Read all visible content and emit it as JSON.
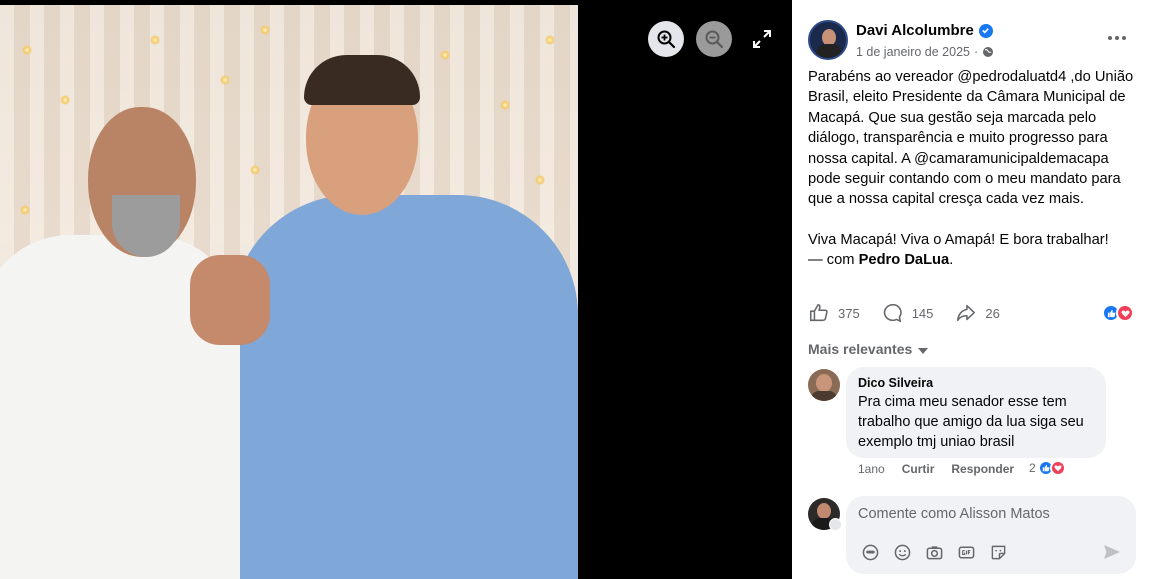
{
  "post": {
    "author": "Davi Alcolumbre",
    "date": "1 de janeiro de 2025",
    "date_sep": "·",
    "text": "Parabéns ao vereador @pedrodaluatd4 ,do União\nBrasil, eleito Presidente da Câmara Municipal de\nMacapá. Que sua gestão seja marcada pelo\ndiálogo, transparência e muito progresso para\nnossa capital. A @camaramunicipaldemacapa\npode seguir contando com o meu mandato para\nque a nossa capital cresça cada vez mais.\n\nViva Macapá! Viva o Amapá! E bora trabalhar!",
    "tag_prefix": "— com ",
    "tag_name": "Pedro DaLua",
    "tag_suffix": "."
  },
  "stats": {
    "likes": "375",
    "comments": "145",
    "shares": "26"
  },
  "comments_section": {
    "sort_label": "Mais relevantes",
    "comment": {
      "author": "Dico Silveira",
      "text": "Pra cima meu senador esse tem\ntrabalho que amigo da lua siga seu\nexemplo tmj uniao brasil",
      "time": "1ano",
      "like_label": "Curtir",
      "reply_label": "Responder",
      "reaction_count": "2"
    }
  },
  "composer": {
    "placeholder": "Comente como Alisson Matos"
  },
  "viewer": {
    "zoom_in_icon": "zoom-in-icon",
    "zoom_out_icon": "zoom-out-icon",
    "fullscreen_icon": "fullscreen-icon"
  },
  "colors": {
    "accent": "#1877f2",
    "love": "#f33e58",
    "muted_text": "#65676b",
    "bubble_bg": "#f0f2f5"
  }
}
